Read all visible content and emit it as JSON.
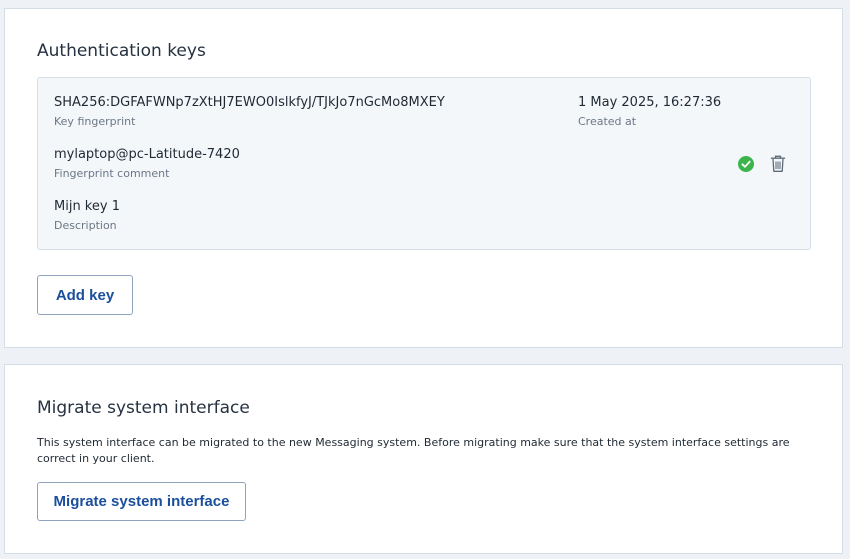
{
  "auth": {
    "title": "Authentication keys",
    "key": {
      "fingerprint": "SHA256:DGFAFWNp7zXtHJ7EWO0IslkfyJ/TJkJo7nGcMo8MXEY",
      "fingerprint_label": "Key fingerprint",
      "comment": "mylaptop@pc-Latitude-7420",
      "comment_label": "Fingerprint comment",
      "description": "Mijn key 1",
      "description_label": "Description",
      "created_at": "1 May 2025, 16:27:36",
      "created_at_label": "Created at",
      "status_icon": "check-circle-icon",
      "delete_icon": "trash-icon"
    },
    "add_button": "Add key"
  },
  "migrate": {
    "title": "Migrate system interface",
    "description": "This system interface can be migrated to the new Messaging system. Before migrating make sure that the system interface settings are correct in your client.",
    "button": "Migrate system interface"
  },
  "colors": {
    "accent": "#1b4f9c",
    "success": "#3cb44b",
    "background": "#eef2f6"
  }
}
